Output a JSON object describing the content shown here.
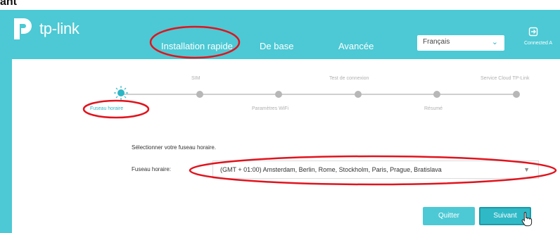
{
  "caption": {
    "text": "ant"
  },
  "header": {
    "logo_text": "tp-link",
    "tabs": [
      {
        "label": "Installation rapide"
      },
      {
        "label": "De base"
      },
      {
        "label": "Avancée"
      }
    ],
    "language": {
      "selected": "Français"
    },
    "connected_label": "Connected A"
  },
  "wizard": {
    "steps": [
      {
        "label": "Fuseau horaire"
      },
      {
        "label": "SIM"
      },
      {
        "label": "Paramètres WiFi"
      },
      {
        "label": "Test de connexion"
      },
      {
        "label": "Résumé"
      },
      {
        "label": "Service Cloud TP-Link"
      }
    ]
  },
  "form": {
    "section_title": "Sélectionner votre fuseau horaire.",
    "timezone_label": "Fuseau horaire:",
    "timezone_value": "(GMT + 01:00) Amsterdam, Berlin, Rome, Stockholm, Paris, Prague, Bratislava"
  },
  "buttons": {
    "quit": "Quitter",
    "next": "Suivant"
  },
  "colors": {
    "brand": "#4cc9d4",
    "accent": "#2bb5c5",
    "annotation": "#e0141e"
  }
}
